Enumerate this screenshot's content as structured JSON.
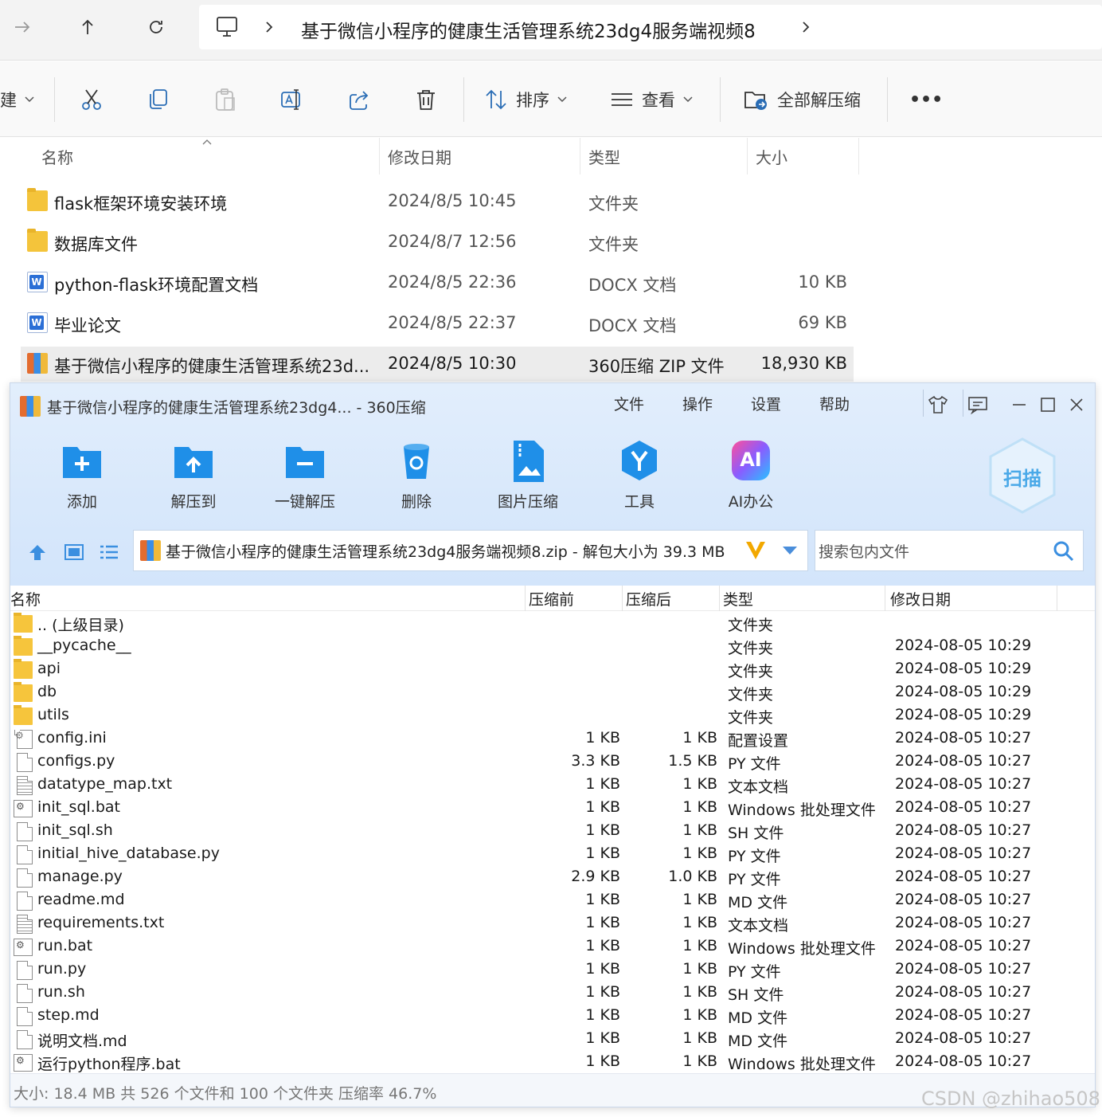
{
  "explorer": {
    "path": "基于微信小程序的健康生活管理系统23dg4服务端视频8",
    "toolbar": {
      "new_label": "建",
      "sort_label": "排序",
      "view_label": "查看",
      "extract_all_label": "全部解压缩",
      "more_label": "•••"
    },
    "columns": {
      "name": "名称",
      "date": "修改日期",
      "type": "类型",
      "size": "大小"
    },
    "rows": [
      {
        "name": "flask框架环境安装环境",
        "date": "2024/8/5 10:45",
        "type": "文件夹",
        "size": "",
        "icon": "folder-icon"
      },
      {
        "name": "数据库文件",
        "date": "2024/8/7 12:56",
        "type": "文件夹",
        "size": "",
        "icon": "folder-icon"
      },
      {
        "name": "python-flask环境配置文档",
        "date": "2024/8/5 22:36",
        "type": "DOCX 文档",
        "size": "10 KB",
        "icon": "docx-icon"
      },
      {
        "name": "毕业论文",
        "date": "2024/8/5 22:37",
        "type": "DOCX 文档",
        "size": "69 KB",
        "icon": "docx-icon"
      },
      {
        "name": "基于微信小程序的健康生活管理系统23d...",
        "date": "2024/8/5 10:30",
        "type": "360压缩 ZIP 文件",
        "size": "18,930 KB",
        "icon": "zip-icon"
      }
    ]
  },
  "zip360": {
    "title": "基于微信小程序的健康生活管理系统23dg4... - 360压缩",
    "menu": [
      "文件",
      "操作",
      "设置",
      "帮助"
    ],
    "tools": [
      "添加",
      "解压到",
      "一键解压",
      "删除",
      "图片压缩",
      "工具",
      "AI办公"
    ],
    "ai_badge": "AI",
    "scan_label": "扫描",
    "archive_path": "基于微信小程序的健康生活管理系统23dg4服务端视频8.zip - 解包大小为 39.3 MB",
    "search_placeholder": "搜索包内文件",
    "columns": {
      "name": "名称",
      "before": "压缩前",
      "after": "压缩后",
      "type": "类型",
      "date": "修改日期"
    },
    "files": [
      {
        "name": ".. (上级目录)",
        "before": "",
        "after": "",
        "type": "文件夹",
        "date": "",
        "icon": "folder"
      },
      {
        "name": "__pycache__",
        "before": "",
        "after": "",
        "type": "文件夹",
        "date": "2024-08-05 10:29",
        "icon": "folder"
      },
      {
        "name": "api",
        "before": "",
        "after": "",
        "type": "文件夹",
        "date": "2024-08-05 10:29",
        "icon": "folder"
      },
      {
        "name": "db",
        "before": "",
        "after": "",
        "type": "文件夹",
        "date": "2024-08-05 10:29",
        "icon": "folder"
      },
      {
        "name": "utils",
        "before": "",
        "after": "",
        "type": "文件夹",
        "date": "2024-08-05 10:29",
        "icon": "folder"
      },
      {
        "name": "config.ini",
        "before": "1 KB",
        "after": "1 KB",
        "type": "配置设置",
        "date": "2024-08-05 10:27",
        "icon": "ini"
      },
      {
        "name": "configs.py",
        "before": "3.3 KB",
        "after": "1.5 KB",
        "type": "PY 文件",
        "date": "2024-08-05 10:27",
        "icon": "file"
      },
      {
        "name": "datatype_map.txt",
        "before": "1 KB",
        "after": "1 KB",
        "type": "文本文档",
        "date": "2024-08-05 10:27",
        "icon": "txt"
      },
      {
        "name": "init_sql.bat",
        "before": "1 KB",
        "after": "1 KB",
        "type": "Windows 批处理文件",
        "date": "2024-08-05 10:27",
        "icon": "bat"
      },
      {
        "name": "init_sql.sh",
        "before": "1 KB",
        "after": "1 KB",
        "type": "SH 文件",
        "date": "2024-08-05 10:27",
        "icon": "file"
      },
      {
        "name": "initial_hive_database.py",
        "before": "1 KB",
        "after": "1 KB",
        "type": "PY 文件",
        "date": "2024-08-05 10:27",
        "icon": "file"
      },
      {
        "name": "manage.py",
        "before": "2.9 KB",
        "after": "1.0 KB",
        "type": "PY 文件",
        "date": "2024-08-05 10:27",
        "icon": "file"
      },
      {
        "name": "readme.md",
        "before": "1 KB",
        "after": "1 KB",
        "type": "MD 文件",
        "date": "2024-08-05 10:27",
        "icon": "file"
      },
      {
        "name": "requirements.txt",
        "before": "1 KB",
        "after": "1 KB",
        "type": "文本文档",
        "date": "2024-08-05 10:27",
        "icon": "txt"
      },
      {
        "name": "run.bat",
        "before": "1 KB",
        "after": "1 KB",
        "type": "Windows 批处理文件",
        "date": "2024-08-05 10:27",
        "icon": "bat"
      },
      {
        "name": "run.py",
        "before": "1 KB",
        "after": "1 KB",
        "type": "PY 文件",
        "date": "2024-08-05 10:27",
        "icon": "file"
      },
      {
        "name": "run.sh",
        "before": "1 KB",
        "after": "1 KB",
        "type": "SH 文件",
        "date": "2024-08-05 10:27",
        "icon": "file"
      },
      {
        "name": "step.md",
        "before": "1 KB",
        "after": "1 KB",
        "type": "MD 文件",
        "date": "2024-08-05 10:27",
        "icon": "file"
      },
      {
        "name": "说明文档.md",
        "before": "1 KB",
        "after": "1 KB",
        "type": "MD 文件",
        "date": "2024-08-05 10:27",
        "icon": "file"
      },
      {
        "name": "运行python程序.bat",
        "before": "1 KB",
        "after": "1 KB",
        "type": "Windows 批处理文件",
        "date": "2024-08-05 10:27",
        "icon": "bat"
      }
    ],
    "status": "大小: 18.4 MB 共 526 个文件和 100 个文件夹 压缩率 46.7%"
  },
  "watermark": "CSDN @zhihao508"
}
